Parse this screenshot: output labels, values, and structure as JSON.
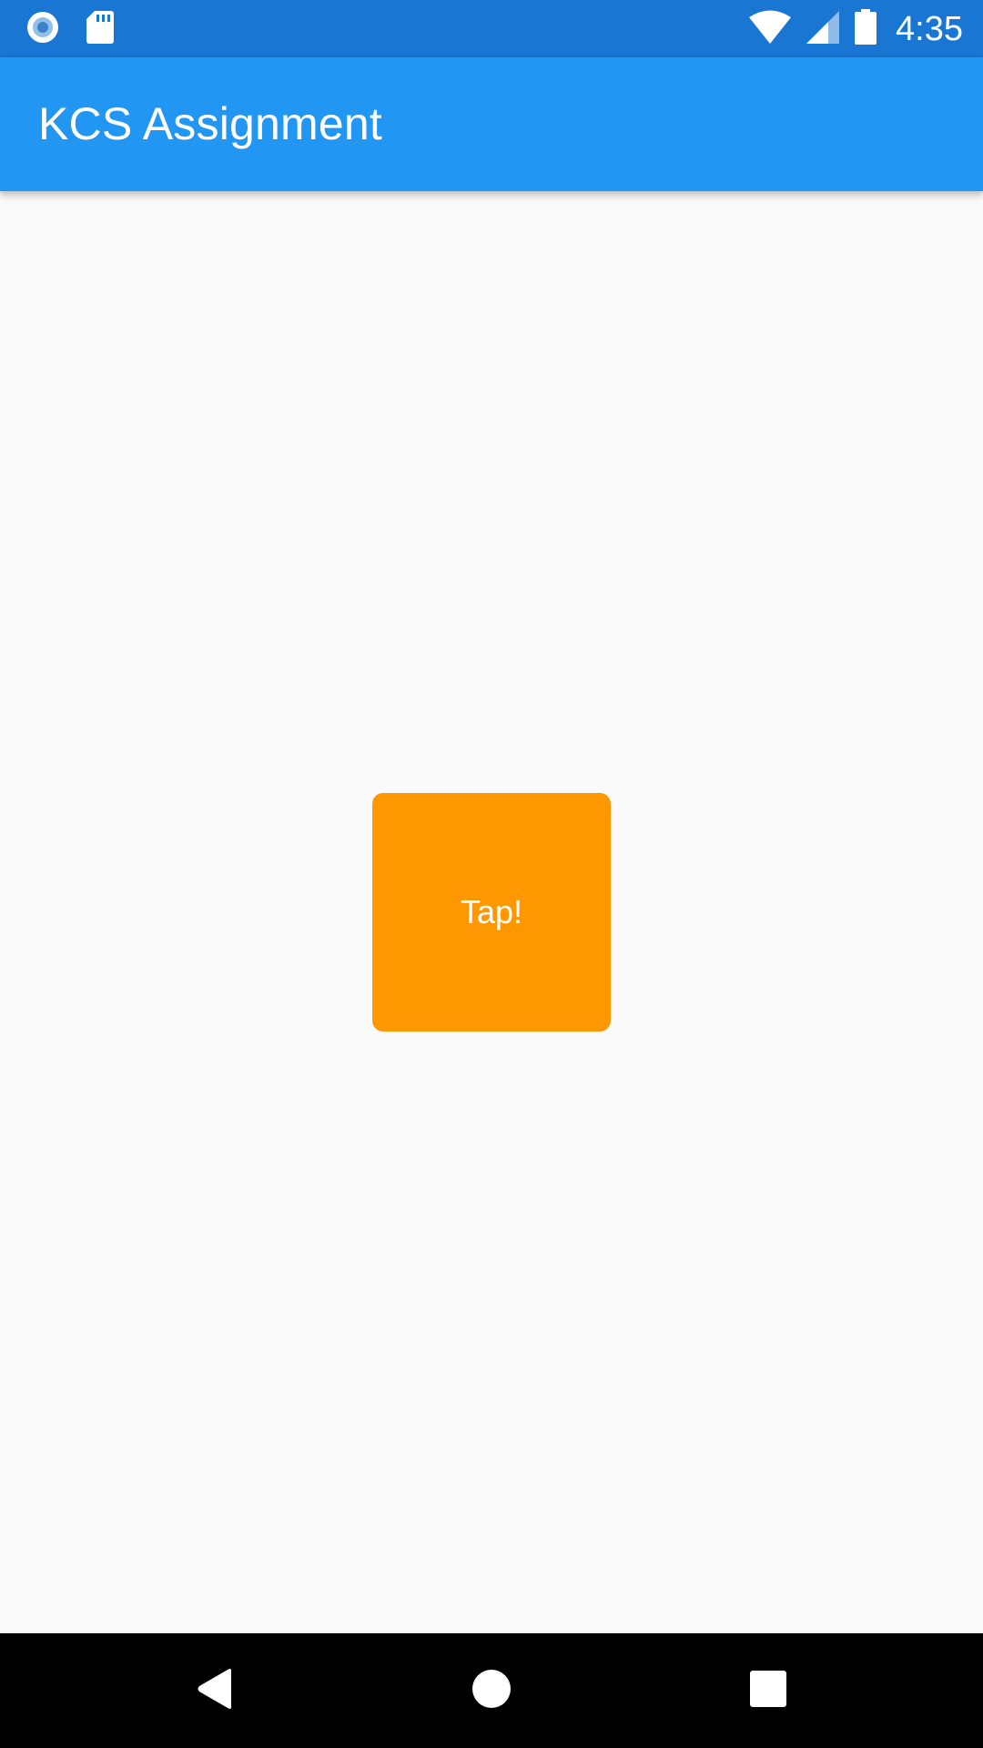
{
  "status_bar": {
    "time": "4:35",
    "left_icons": [
      "record-icon",
      "sd-card-icon"
    ],
    "right_icons": [
      "wifi-icon",
      "cell-signal-icon",
      "battery-icon"
    ],
    "background_color": "#1976d2"
  },
  "app_bar": {
    "title": "KCS Assignment",
    "background_color": "#2196f3"
  },
  "main": {
    "tap_button": {
      "label": "Tap!",
      "color": "#ff9800"
    }
  },
  "nav_bar": {
    "buttons": [
      "back-icon",
      "home-icon",
      "recents-icon"
    ]
  }
}
